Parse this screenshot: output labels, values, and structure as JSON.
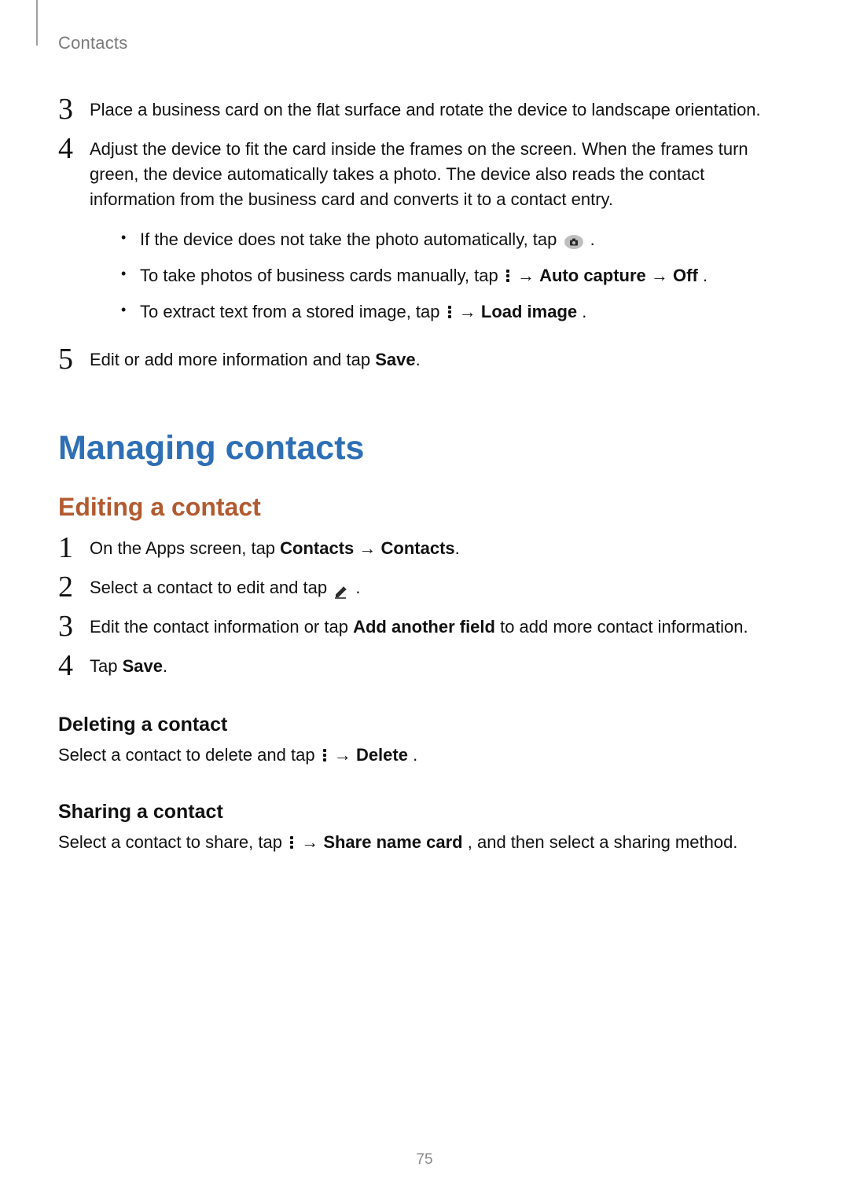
{
  "header": {
    "section": "Contacts"
  },
  "steps_top": [
    {
      "num": "3",
      "text": "Place a business card on the flat surface and rotate the device to landscape orientation."
    },
    {
      "num": "4",
      "text": "Adjust the device to fit the card inside the frames on the screen. When the frames turn green, the device automatically takes a photo. The device also reads the contact information from the business card and converts it to a contact entry."
    },
    {
      "num": "5",
      "text_pre": "Edit or add more information and tap ",
      "bold": "Save",
      "text_post": "."
    }
  ],
  "step4_bullets": {
    "b1_pre": "If the device does not take the photo automatically, tap ",
    "b1_post": ".",
    "b2_pre": "To take photos of business cards manually, tap ",
    "b2_arrow1": " → ",
    "b2_bold1": "Auto capture",
    "b2_arrow2": " → ",
    "b2_bold2": "Off",
    "b2_post": ".",
    "b3_pre": "To extract text from a stored image, tap ",
    "b3_arrow": " → ",
    "b3_bold": "Load image",
    "b3_post": "."
  },
  "h1": "Managing contacts",
  "h2": "Editing a contact",
  "edit_steps": {
    "s1_num": "1",
    "s1_pre": "On the Apps screen, tap ",
    "s1_b1": "Contacts",
    "s1_arrow": " → ",
    "s1_b2": "Contacts",
    "s1_post": ".",
    "s2_num": "2",
    "s2_pre": "Select a contact to edit and tap ",
    "s2_post": ".",
    "s3_num": "3",
    "s3_pre": "Edit the contact information or tap ",
    "s3_bold": "Add another field",
    "s3_post": " to add more contact information.",
    "s4_num": "4",
    "s4_pre": "Tap ",
    "s4_bold": "Save",
    "s4_post": "."
  },
  "delete": {
    "title": "Deleting a contact",
    "pre": "Select a contact to delete and tap ",
    "arrow": " → ",
    "bold": "Delete",
    "post": "."
  },
  "share": {
    "title": "Sharing a contact",
    "pre": "Select a contact to share, tap ",
    "arrow": " → ",
    "bold": "Share name card",
    "post": ", and then select a sharing method."
  },
  "page_number": "75"
}
